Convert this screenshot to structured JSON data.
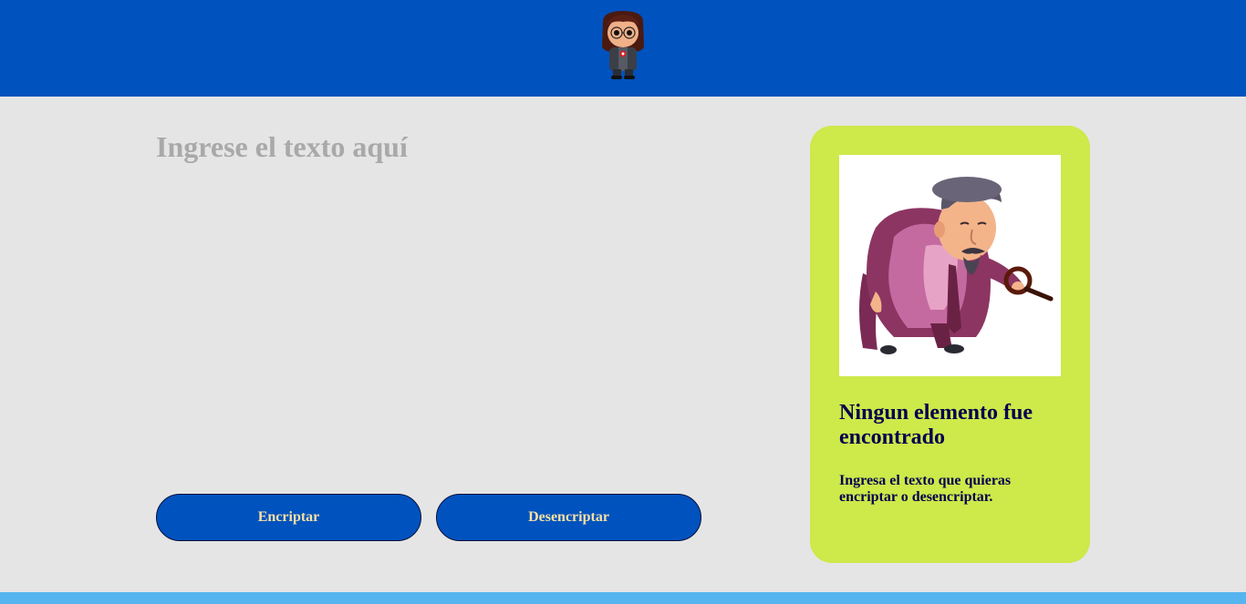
{
  "header": {
    "logo_icon": "girl-avatar-icon",
    "background": "#0052be"
  },
  "input": {
    "placeholder": "Ingrese el texto aquí",
    "value": ""
  },
  "buttons": {
    "encrypt_label": "Encriptar",
    "decrypt_label": "Desencriptar"
  },
  "result_panel": {
    "image_icon": "detective-magnifier-illustration",
    "title": "Ningun elemento fue encontrado",
    "message": "Ingresa el texto que quieras encriptar o desencriptar."
  },
  "colors": {
    "primary": "#0052be",
    "panel": "#cde94a",
    "background": "#e5e5e5",
    "footer": "#56b4ee",
    "button_text": "#f5e0a3",
    "panel_text": "#06004f"
  }
}
